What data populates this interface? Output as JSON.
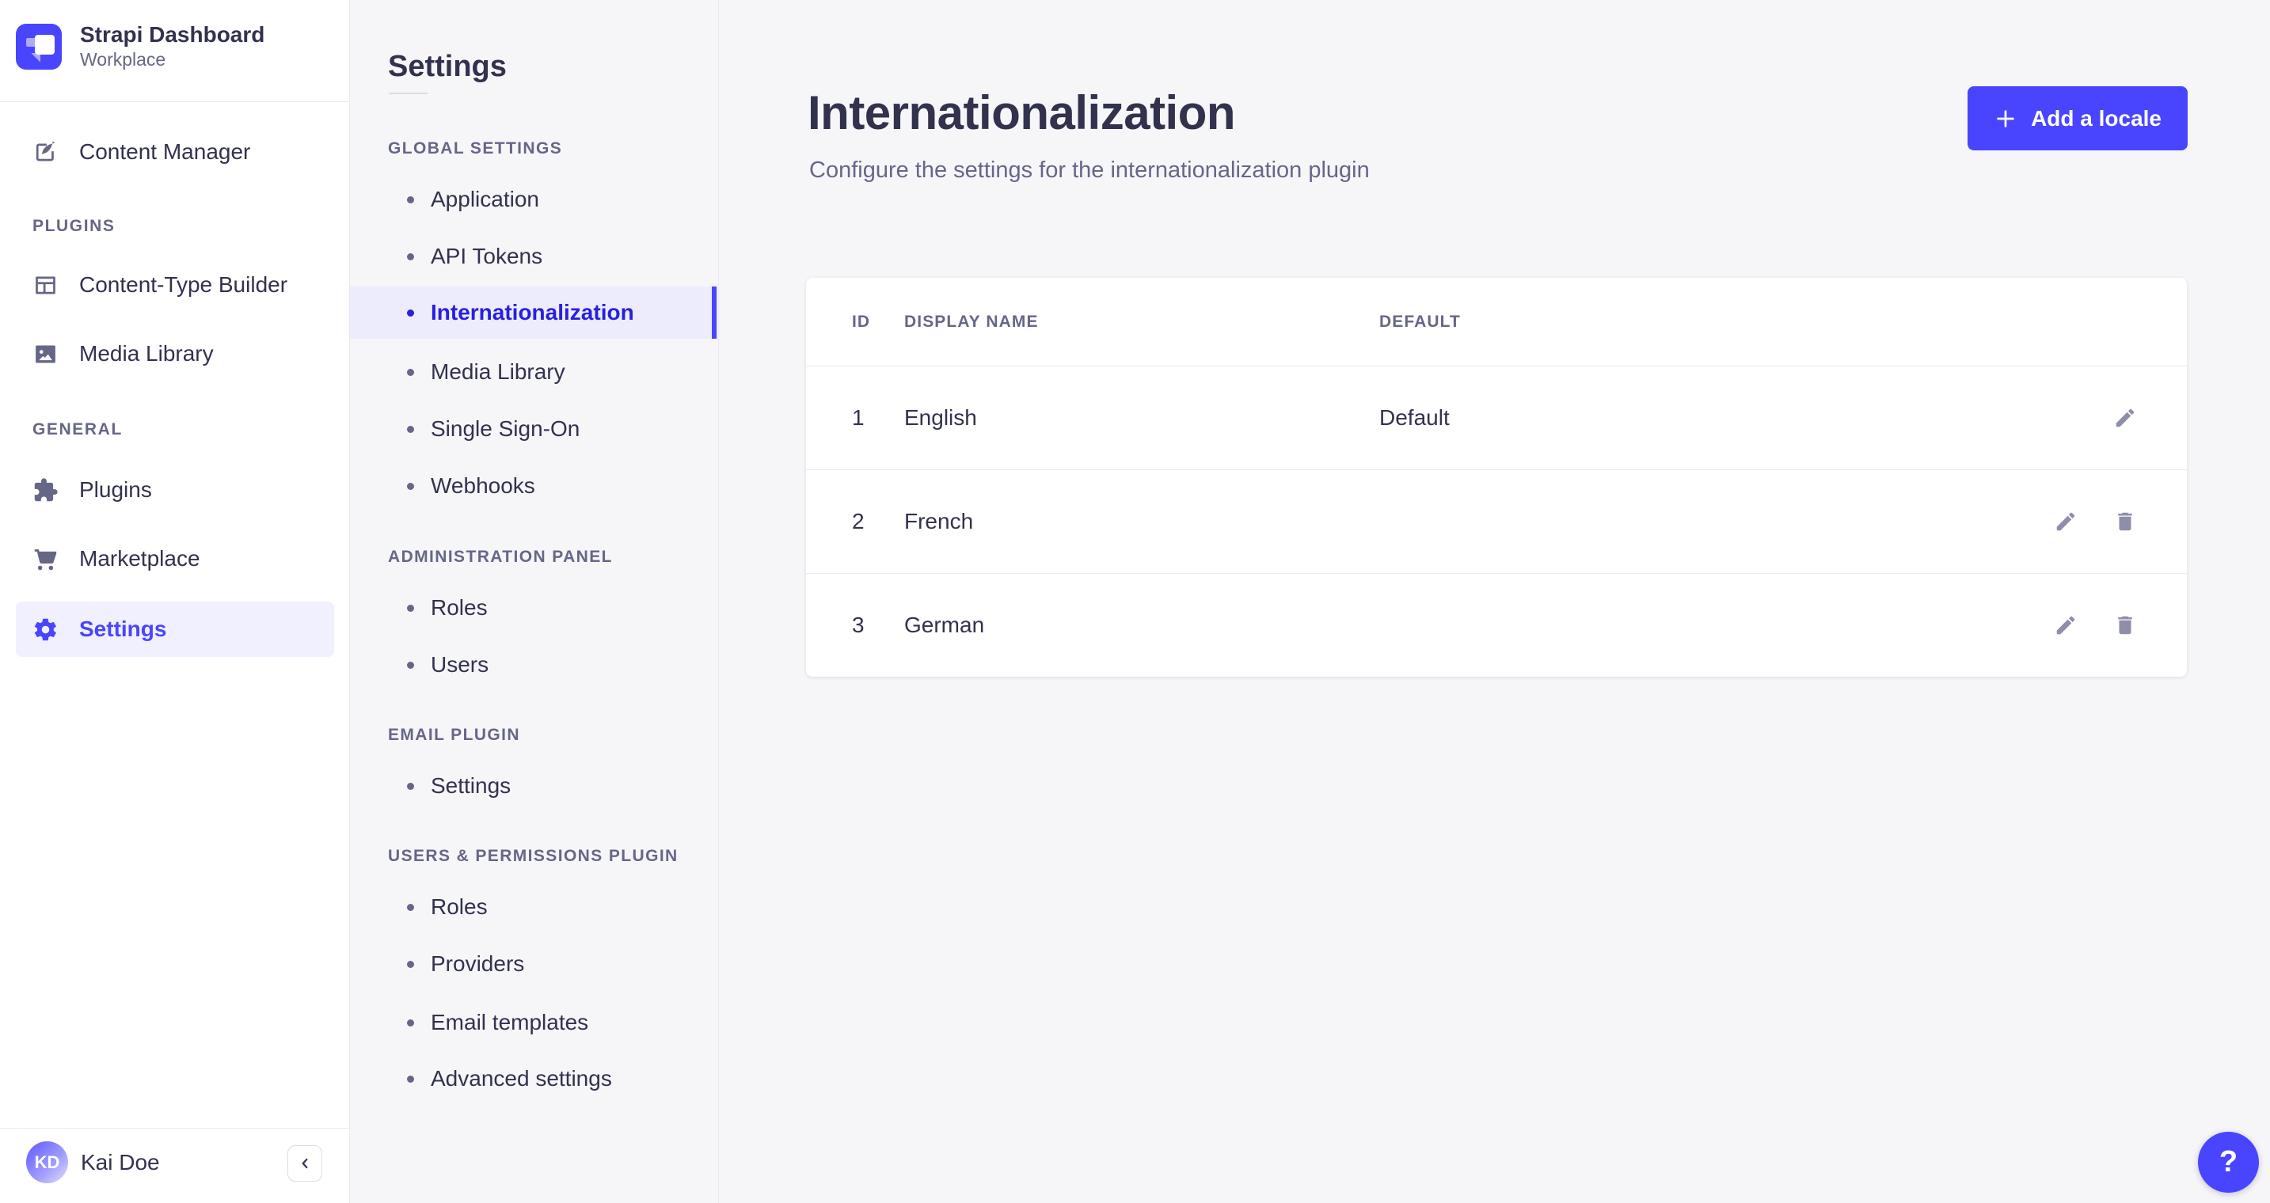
{
  "brand": {
    "name": "Strapi Dashboard",
    "workspace": "Workplace"
  },
  "main_nav": {
    "content_manager": "Content Manager",
    "sections": [
      {
        "header": "PLUGINS",
        "items": [
          {
            "label": "Content-Type Builder"
          },
          {
            "label": "Media Library"
          }
        ]
      },
      {
        "header": "GENERAL",
        "items": [
          {
            "label": "Plugins"
          },
          {
            "label": "Marketplace"
          },
          {
            "label": "Settings"
          }
        ]
      }
    ],
    "user": {
      "initials": "KD",
      "name": "Kai Doe"
    }
  },
  "subnav": {
    "title": "Settings",
    "sections": [
      {
        "header": "GLOBAL SETTINGS",
        "items": [
          {
            "label": "Application"
          },
          {
            "label": "API Tokens"
          },
          {
            "label": "Internationalization"
          },
          {
            "label": "Media Library"
          },
          {
            "label": "Single Sign-On"
          },
          {
            "label": "Webhooks"
          }
        ]
      },
      {
        "header": "ADMINISTRATION PANEL",
        "items": [
          {
            "label": "Roles"
          },
          {
            "label": "Users"
          }
        ]
      },
      {
        "header": "EMAIL PLUGIN",
        "items": [
          {
            "label": "Settings"
          }
        ]
      },
      {
        "header": "USERS & PERMISSIONS PLUGIN",
        "items": [
          {
            "label": "Roles"
          },
          {
            "label": "Providers"
          },
          {
            "label": "Email templates"
          },
          {
            "label": "Advanced settings"
          }
        ]
      }
    ],
    "active_item": "Internationalization"
  },
  "page": {
    "title": "Internationalization",
    "subtitle": "Configure the settings for the internationalization plugin",
    "add_locale_button": "Add a locale"
  },
  "table": {
    "headers": {
      "id": "ID",
      "display_name": "DISPLAY NAME",
      "default": "DEFAULT"
    },
    "rows": [
      {
        "id": "1",
        "display_name": "English",
        "default": "Default"
      },
      {
        "id": "2",
        "display_name": "French",
        "default": ""
      },
      {
        "id": "3",
        "display_name": "German",
        "default": ""
      }
    ]
  },
  "help": {
    "label": "?"
  },
  "colors": {
    "primary": "#4945ff",
    "primary_dark": "#271fe0",
    "highlight": "#f0f0ff",
    "background": "#f6f6f9",
    "border": "#eaeaef",
    "text_dark": "#32324d",
    "text_gray": "#666687",
    "icon_gray": "#8e8ea9"
  }
}
